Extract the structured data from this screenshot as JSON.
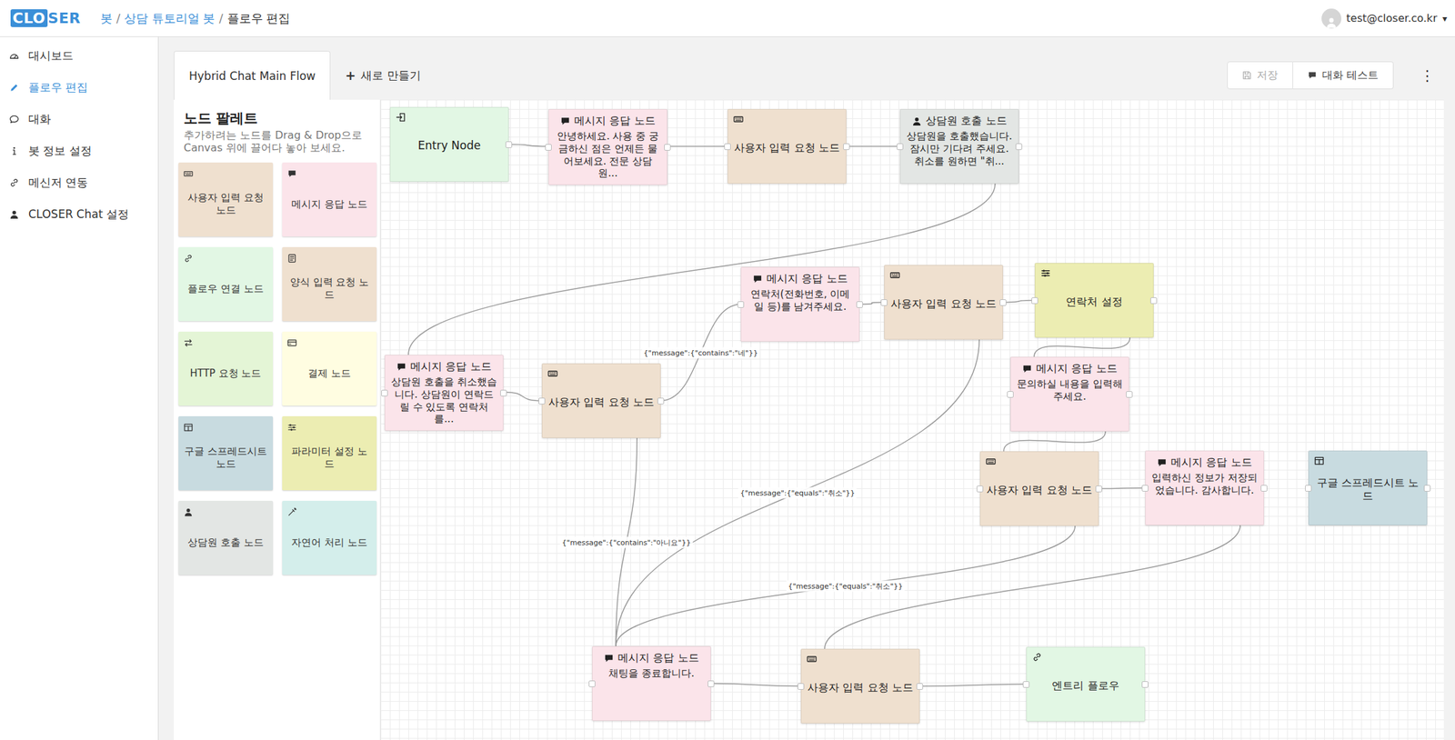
{
  "logo": {
    "boxed": "CLO",
    "rest": "SER"
  },
  "breadcrumb": {
    "separator": "/",
    "items": [
      {
        "label": "봇",
        "current": false
      },
      {
        "label": "상담 튜토리얼 봇",
        "current": false
      },
      {
        "label": "플로우 편집",
        "current": true
      }
    ]
  },
  "user": {
    "email": "test@closer.co.kr",
    "caret": "▾"
  },
  "sidebar": {
    "items": [
      {
        "label": "대시보드",
        "selected": false
      },
      {
        "label": "플로우 편집",
        "selected": true
      },
      {
        "label": "대화",
        "selected": false
      },
      {
        "label": "봇 정보 설정",
        "selected": false
      },
      {
        "label": "메신저 연동",
        "selected": false
      },
      {
        "label": "CLOSER Chat 설정",
        "selected": false
      }
    ]
  },
  "tabs": [
    {
      "label": "Hybrid Chat Main Flow",
      "selected": true
    }
  ],
  "new_tab": {
    "icon": "+",
    "label": "새로 만들기"
  },
  "actions": [
    {
      "label": "저장",
      "disabled": true
    },
    {
      "label": "대화 테스트",
      "disabled": false
    }
  ],
  "more": "⋮",
  "palette": {
    "title": "노드 팔레트",
    "description": "추가하려는 노드를 Drag & Drop으로 Canvas 위에 끌어다 놓아 보세요.",
    "items": [
      {
        "label": "사용자 입력 요청 노드",
        "kind": "input",
        "color": "#efe0cf"
      },
      {
        "label": "메시지 응답 노드",
        "kind": "message",
        "color": "#fbe4ea"
      },
      {
        "label": "플로우 연결 노드",
        "kind": "flow",
        "color": "#e2f7e4"
      },
      {
        "label": "양식 입력 요청 노드",
        "kind": "form",
        "color": "#efe0cf"
      },
      {
        "label": "HTTP 요청 노드",
        "kind": "http",
        "color": "#e4f5d6"
      },
      {
        "label": "결제 노드",
        "kind": "payment",
        "color": "#fffde1"
      },
      {
        "label": "구글 스프레드시트 노드",
        "kind": "sheet",
        "color": "#c8dbe0"
      },
      {
        "label": "파라미터 설정 노드",
        "kind": "param",
        "color": "#ecedb2"
      },
      {
        "label": "상담원 호출 노드",
        "kind": "agent",
        "color": "#e3e6e4"
      },
      {
        "label": "자연어 처리 노드",
        "kind": "nlp",
        "color": "#d4eeeb"
      }
    ]
  },
  "nodes": [
    {
      "title": "Entry Node",
      "kind": "entry",
      "color": "#e2f7e4"
    },
    {
      "title": "메시지 응답 노드",
      "kind": "message",
      "color": "#fbe4ea",
      "body": "안녕하세요. 사용 중 궁금하신 점은 언제든 물어보세요. 전문 상담원..."
    },
    {
      "title": "사용자 입력 요청 노드",
      "kind": "input",
      "color": "#efe0cf"
    },
    {
      "title": "상담원 호출 노드",
      "kind": "agent",
      "color": "#e3e6e4",
      "body": "상담원을 호출했습니다. 잠시만 기다려 주세요. 취소를 원하면 \"취..."
    },
    {
      "title": "메시지 응답 노드",
      "kind": "message",
      "color": "#fbe4ea",
      "body": "연락처(전화번호, 이메일 등)를 남겨주세요."
    },
    {
      "title": "사용자 입력 요청 노드",
      "kind": "input",
      "color": "#efe0cf"
    },
    {
      "title": "연락처 설정",
      "kind": "param",
      "color": "#ecedb2"
    },
    {
      "title": "메시지 응답 노드",
      "kind": "message",
      "color": "#fbe4ea",
      "body": "상담원 호출을 취소했습니다. 상담원이 연락드릴 수 있도록 연락처를..."
    },
    {
      "title": "사용자 입력 요청 노드",
      "kind": "input",
      "color": "#efe0cf"
    },
    {
      "title": "메시지 응답 노드",
      "kind": "message",
      "color": "#fbe4ea",
      "body": "문의하실 내용을 입력해 주세요."
    },
    {
      "title": "사용자 입력 요청 노드",
      "kind": "input",
      "color": "#efe0cf"
    },
    {
      "title": "메시지 응답 노드",
      "kind": "message",
      "color": "#fbe4ea",
      "body": "입력하신 정보가 저장되었습니다. 감사합니다."
    },
    {
      "title": "구글 스프레드시트 노드",
      "kind": "sheet",
      "color": "#c8dbe0"
    },
    {
      "title": "메시지 응답 노드",
      "kind": "message",
      "color": "#fbe4ea",
      "body": "채팅을 종료합니다."
    },
    {
      "title": "사용자 입력 요청 노드",
      "kind": "input",
      "color": "#efe0cf"
    },
    {
      "title": "엔트리 플로우",
      "kind": "flow",
      "color": "#e2f7e4"
    }
  ],
  "edges": [
    {
      "from": 0,
      "to": 1
    },
    {
      "from": 1,
      "to": 2
    },
    {
      "from": 2,
      "to": 3
    },
    {
      "from": 3,
      "to": 7
    },
    {
      "from": 7,
      "to": 8
    },
    {
      "from": 8,
      "to": 4,
      "label": "{\"message\":{\"contains\":\"네\"}}"
    },
    {
      "from": 4,
      "to": 5
    },
    {
      "from": 5,
      "to": 6
    },
    {
      "from": 6,
      "to": 9
    },
    {
      "from": 9,
      "to": 10
    },
    {
      "from": 10,
      "to": 11
    },
    {
      "from": 8,
      "to": 13,
      "label": "{\"message\":{\"contains\":\"아니요\"}}"
    },
    {
      "from": 5,
      "to": 13,
      "label": "{\"message\":{\"equals\":\"취소\"}}"
    },
    {
      "from": 10,
      "to": 13,
      "label": "{\"message\":{\"equals\":\"취소\"}}"
    },
    {
      "from": 11,
      "to": 14
    },
    {
      "from": 13,
      "to": 14
    },
    {
      "from": 14,
      "to": 15
    }
  ]
}
